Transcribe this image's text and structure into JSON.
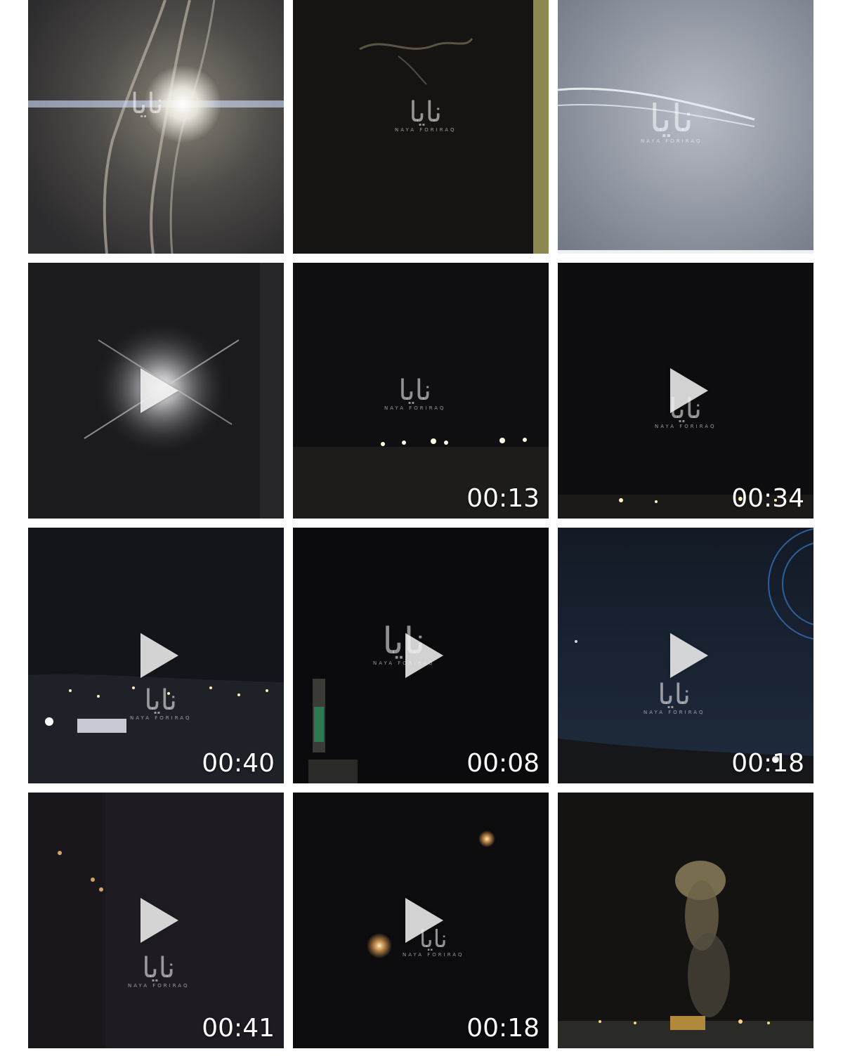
{
  "gallery": {
    "watermark": {
      "arabic": "نايا",
      "latin": "NAYA FORIRAQ"
    },
    "tiles": [
      {
        "type": "image",
        "duration": ""
      },
      {
        "type": "image",
        "duration": ""
      },
      {
        "type": "image",
        "duration": ""
      },
      {
        "type": "video",
        "duration": ""
      },
      {
        "type": "video",
        "duration": "00:13"
      },
      {
        "type": "video",
        "duration": "00:34"
      },
      {
        "type": "video",
        "duration": "00:40"
      },
      {
        "type": "video",
        "duration": "00:08"
      },
      {
        "type": "video",
        "duration": "00:18"
      },
      {
        "type": "video",
        "duration": "00:41"
      },
      {
        "type": "video",
        "duration": "00:18"
      },
      {
        "type": "image",
        "duration": ""
      }
    ]
  }
}
